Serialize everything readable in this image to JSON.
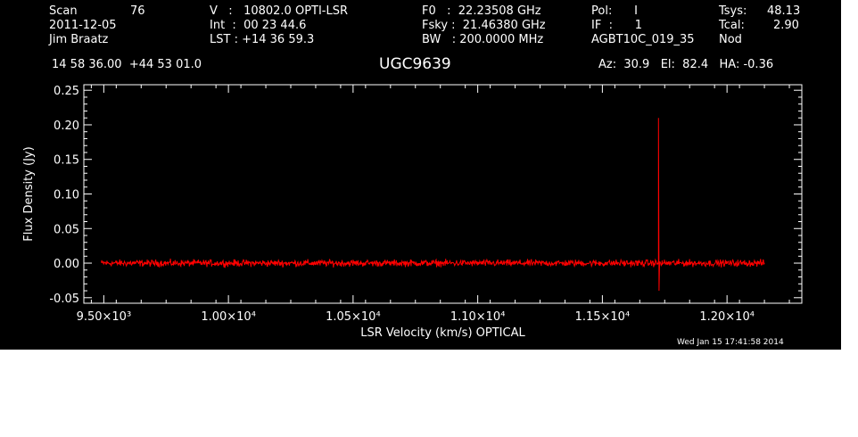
{
  "header": {
    "col1": [
      {
        "label": "Scan",
        "value": "76"
      },
      {
        "text": "2011-12-05"
      },
      {
        "text": "Jim Braatz"
      }
    ],
    "col2": [
      "V   :   10802.0 OPTI-LSR",
      "Int  :  00 23 44.6",
      "LST : +14 36 59.3"
    ],
    "col3": [
      "F0   :  22.23508 GHz",
      "Fsky :  21.46380 GHz",
      "BW   : 200.0000 MHz"
    ],
    "col4": [
      "Pol:      I",
      "IF  :      1",
      "AGBT10C_019_35"
    ],
    "col5": [
      {
        "label": "Tsys:",
        "value": "48.13"
      },
      {
        "label": "Tcal:",
        "value": "2.90"
      },
      {
        "label": "Nod",
        "value": ""
      }
    ],
    "coords": "14 58 36.00  +44 53 01.0",
    "source": "UGC9639",
    "azelha": "Az:  30.9   El:  82.4   HA: -0.36"
  },
  "footer": {
    "timestamp": "Wed Jan 15 17:41:58 2014"
  },
  "colors": {
    "background": "#000000",
    "axes": "#ffffff",
    "series": "#ff0000"
  },
  "chart_data": {
    "type": "line",
    "xlabel": "LSR Velocity (km/s) OPTICAL",
    "ylabel": "Flux Density (Jy)",
    "xlim": [
      9420,
      12300
    ],
    "ylim": [
      -0.058,
      0.258
    ],
    "xticks": [
      {
        "value": 9500,
        "label": "9.50×10³"
      },
      {
        "value": 10000,
        "label": "1.00×10⁴"
      },
      {
        "value": 10500,
        "label": "1.05×10⁴"
      },
      {
        "value": 11000,
        "label": "1.10×10⁴"
      },
      {
        "value": 11500,
        "label": "1.15×10⁴"
      },
      {
        "value": 12000,
        "label": "1.20×10⁴"
      }
    ],
    "yticks": [
      {
        "value": -0.05,
        "label": "-0.05"
      },
      {
        "value": 0.0,
        "label": "0.00"
      },
      {
        "value": 0.05,
        "label": "0.05"
      },
      {
        "value": 0.1,
        "label": "0.10"
      },
      {
        "value": 0.15,
        "label": "0.15"
      },
      {
        "value": 0.2,
        "label": "0.20"
      },
      {
        "value": 0.25,
        "label": "0.25"
      }
    ],
    "series": [
      {
        "x_start": 9490,
        "x_end": 12150,
        "baseline": 0.0,
        "noise_rms": 0.003,
        "features": [
          {
            "x": 11725,
            "peak": 0.21,
            "trough": -0.04
          }
        ]
      }
    ]
  }
}
